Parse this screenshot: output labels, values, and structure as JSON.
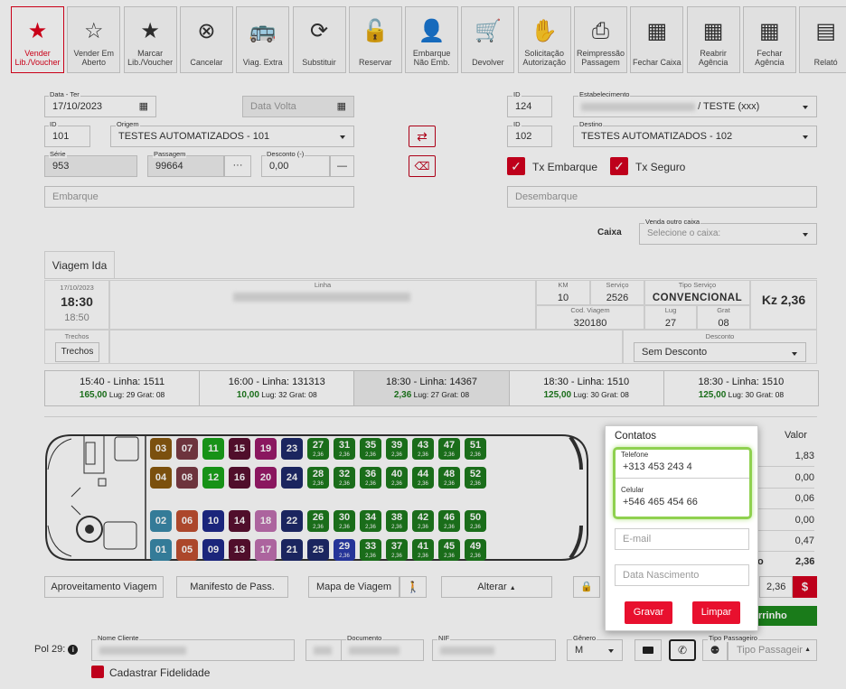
{
  "toolbar": [
    {
      "label": "Vender Lib./Voucher",
      "icon": "star-icon"
    },
    {
      "label": "Vender Em Aberto",
      "icon": "star-outline-icon"
    },
    {
      "label": "Marcar Lib./Voucher",
      "icon": "star-filled-icon"
    },
    {
      "label": "Cancelar",
      "icon": "cancel-circle-icon"
    },
    {
      "label": "Viag. Extra",
      "icon": "bus-icon"
    },
    {
      "label": "Substituir",
      "icon": "sync-icon"
    },
    {
      "label": "Reservar",
      "icon": "unlock-icon"
    },
    {
      "label": "Embarque Não Emb.",
      "icon": "user-plus-icon"
    },
    {
      "label": "Devolver",
      "icon": "cart-return-icon"
    },
    {
      "label": "Solicitação Autorização",
      "icon": "hand-icon"
    },
    {
      "label": "Reimpressão Passagem",
      "icon": "printer-icon"
    },
    {
      "label": "Fechar Caixa",
      "icon": "cash-register-icon"
    },
    {
      "label": "Reabrir Agência",
      "icon": "cash-register-icon"
    },
    {
      "label": "Fechar Agência",
      "icon": "cash-register-icon"
    },
    {
      "label": "Relató",
      "icon": "document-icon"
    }
  ],
  "form": {
    "data_ter_label": "Data - Ter",
    "data_ter": "17/10/2023",
    "data_volta_placeholder": "Data Volta",
    "id_label": "ID",
    "origem_id": "101",
    "origem_label": "Origem",
    "origem": "TESTES AUTOMATIZADOS - 101",
    "serie_label": "Série",
    "serie": "953",
    "passagem_label": "Passagem",
    "passagem": "99664",
    "passagem_more": "···",
    "desconto_label": "Desconto (-)",
    "desconto": "0,00",
    "desconto_minus": "—",
    "embarque_placeholder": "Embarque",
    "estab_id": "124",
    "estab_label": "Estabelecimento",
    "estab": "/ TESTE (xxx)",
    "destino_id": "102",
    "destino_label": "Destino",
    "destino": "TESTES AUTOMATIZADOS - 102",
    "tx_embarque": "Tx Embarque",
    "tx_seguro": "Tx Seguro",
    "desembarque_placeholder": "Desembarque",
    "caixa_label": "Caixa",
    "venda_outro_caixa_label": "Venda outro caixa",
    "venda_outro_caixa_placeholder": "Selecione o caixa:"
  },
  "trip": {
    "tab": "Viagem Ida",
    "date": "17/10/2023",
    "dep": "18:30",
    "arr": "18:50",
    "linha_label": "Linha",
    "km_label": "KM",
    "km": "10",
    "servico_label": "Serviço",
    "servico": "2526",
    "tipo_servico_label": "Tipo Serviço",
    "tipo_servico": "CONVENCIONAL",
    "price": "Kz 2,36",
    "cod_viagem_label": "Cod. Viagem",
    "cod_viagem": "320180",
    "lug_label": "Lug",
    "lug": "27",
    "grat_label": "Grat",
    "grat": "08",
    "trechos_label": "Trechos",
    "trechos_btn": "Trechos",
    "desconto_label": "Desconto",
    "desconto_select": "Sem Desconto"
  },
  "trip_options": [
    {
      "title": "15:40 - Linha: 1511",
      "price": "165,00",
      "info": " Lug: 29 Grat: 08"
    },
    {
      "title": "16:00 - Linha: 131313",
      "price": "10,00",
      "info": " Lug: 32 Grat: 08"
    },
    {
      "title": "18:30 - Linha: 14367",
      "price": "2,36",
      "info": " Lug: 27 Grat: 08"
    },
    {
      "title": "18:30 - Linha: 1510",
      "price": "125,00",
      "info": " Lug: 30 Grat: 08"
    },
    {
      "title": "18:30 - Linha: 1510",
      "price": "125,00",
      "info": " Lug: 30 Grat: 08"
    }
  ],
  "seat_price": "2,36",
  "seats": [
    {
      "n": "03",
      "color": "#8a5a10"
    },
    {
      "n": "07",
      "color": "#7a3a44"
    },
    {
      "n": "11",
      "color": "#1aa31a"
    },
    {
      "n": "15",
      "color": "#5a1030"
    },
    {
      "n": "19",
      "color": "#9a1a6a"
    },
    {
      "n": "23",
      "color": "#1f2a6a"
    },
    {
      "n": "27",
      "color": "#1e7a1e",
      "p": true
    },
    {
      "n": "31",
      "color": "#1e7a1e",
      "p": true
    },
    {
      "n": "35",
      "color": "#1e7a1e",
      "p": true
    },
    {
      "n": "39",
      "color": "#1e7a1e",
      "p": true
    },
    {
      "n": "43",
      "color": "#1e7a1e",
      "p": true
    },
    {
      "n": "47",
      "color": "#1e7a1e",
      "p": true
    },
    {
      "n": "51",
      "color": "#1e7a1e",
      "p": true
    },
    {
      "n": "04",
      "color": "#8a5a10"
    },
    {
      "n": "08",
      "color": "#7a3a44"
    },
    {
      "n": "12",
      "color": "#1aa31a"
    },
    {
      "n": "16",
      "color": "#5a1030"
    },
    {
      "n": "20",
      "color": "#9a1a6a"
    },
    {
      "n": "24",
      "color": "#1f2a6a"
    },
    {
      "n": "28",
      "color": "#1e7a1e",
      "p": true
    },
    {
      "n": "32",
      "color": "#1e7a1e",
      "p": true
    },
    {
      "n": "36",
      "color": "#1e7a1e",
      "p": true
    },
    {
      "n": "40",
      "color": "#1e7a1e",
      "p": true
    },
    {
      "n": "44",
      "color": "#1e7a1e",
      "p": true
    },
    {
      "n": "48",
      "color": "#1e7a1e",
      "p": true
    },
    {
      "n": "52",
      "color": "#1e7a1e",
      "p": true
    },
    {
      "n": "02",
      "color": "#3a8aaa"
    },
    {
      "n": "06",
      "color": "#c05030"
    },
    {
      "n": "10",
      "color": "#1f2a8a"
    },
    {
      "n": "14",
      "color": "#5a1030"
    },
    {
      "n": "18",
      "color": "#c070b0"
    },
    {
      "n": "22",
      "color": "#1f2a6a"
    },
    {
      "n": "26",
      "color": "#1e7a1e",
      "p": true
    },
    {
      "n": "30",
      "color": "#1e7a1e",
      "p": true
    },
    {
      "n": "34",
      "color": "#1e7a1e",
      "p": true
    },
    {
      "n": "38",
      "color": "#1e7a1e",
      "p": true
    },
    {
      "n": "42",
      "color": "#1e7a1e",
      "p": true
    },
    {
      "n": "46",
      "color": "#1e7a1e",
      "p": true
    },
    {
      "n": "50",
      "color": "#1e7a1e",
      "p": true
    },
    {
      "n": "01",
      "color": "#3a8aaa"
    },
    {
      "n": "05",
      "color": "#c05030"
    },
    {
      "n": "09",
      "color": "#1f2a8a"
    },
    {
      "n": "13",
      "color": "#5a1030"
    },
    {
      "n": "17",
      "color": "#c070b0"
    },
    {
      "n": "21",
      "color": "#1f2a6a"
    },
    {
      "n": "25",
      "color": "#1f2a6a"
    },
    {
      "n": "29",
      "color": "#2a3aaa",
      "p": true
    },
    {
      "n": "33",
      "color": "#1e7a1e",
      "p": true
    },
    {
      "n": "37",
      "color": "#1e7a1e",
      "p": true
    },
    {
      "n": "41",
      "color": "#1e7a1e",
      "p": true
    },
    {
      "n": "45",
      "color": "#1e7a1e",
      "p": true
    },
    {
      "n": "49",
      "color": "#1e7a1e",
      "p": true
    }
  ],
  "values": {
    "header": "Valor",
    "rows": [
      "1,83",
      "0,00",
      "0,06",
      "0,00",
      "0,47"
    ],
    "total_prefix": "o",
    "total": "2,36",
    "price_field": "2,36",
    "dollar": "$",
    "green_btn": "rrinho"
  },
  "actions": {
    "aproveitamento": "Aproveitamento Viagem",
    "manifesto": "Manifesto de Pass.",
    "mapa": "Mapa de Viagem",
    "alterar": "Alterar"
  },
  "passenger": {
    "pol": "Pol 29:",
    "nome_label": "Nome Cliente",
    "documento_label": "Documento",
    "nif_label": "NIF",
    "genero_label": "Gênero",
    "genero": "M",
    "tipo_label": "Tipo Passageiro",
    "tipo_placeholder": "Tipo Passageir",
    "fidelidade": "Cadastrar Fidelidade"
  },
  "contatos": {
    "title": "Contatos",
    "telefone_label": "Telefone",
    "telefone": "+313 453 243 4",
    "celular_label": "Celular",
    "celular": "+546 465 454 66",
    "email_placeholder": "E-mail",
    "nascimento_placeholder": "Data Nascimento",
    "gravar": "Gravar",
    "limpar": "Limpar"
  }
}
